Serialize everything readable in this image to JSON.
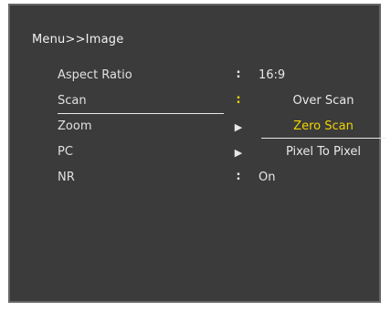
{
  "menu": {
    "title": "Menu>>Image",
    "rows": [
      {
        "label": "Aspect Ratio",
        "separator": ":",
        "value": "16:9"
      },
      {
        "label": "Scan",
        "separator": ":"
      },
      {
        "label": "Zoom",
        "separator": "▶"
      },
      {
        "label": "PC",
        "separator": "▶"
      },
      {
        "label": "NR",
        "separator": ":",
        "value": "On"
      }
    ],
    "scan_options": [
      {
        "label": "Over Scan"
      },
      {
        "label": "Zero Scan"
      },
      {
        "label": "Pixel To Pixel"
      }
    ]
  },
  "colors": {
    "panel_background": "#3b3b3b",
    "highlight": "#f0d400",
    "text": "#e8e8e8"
  }
}
